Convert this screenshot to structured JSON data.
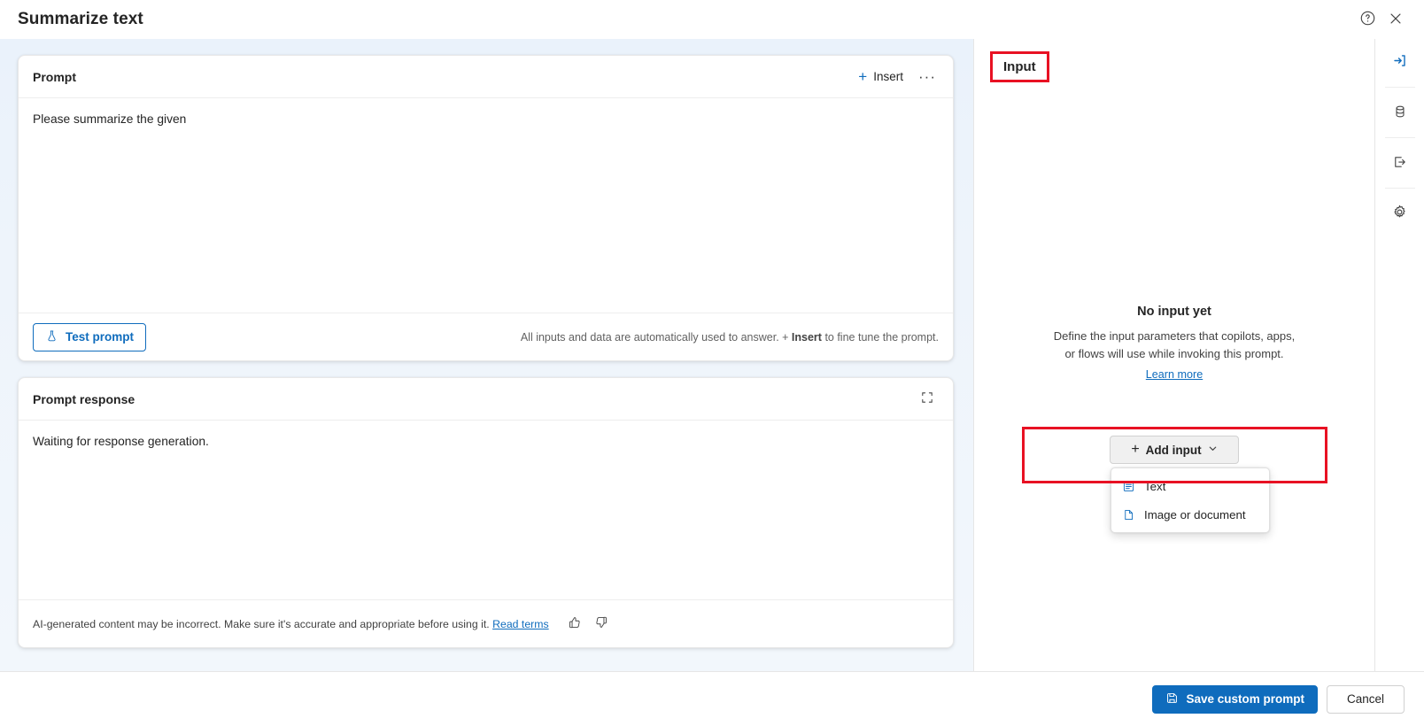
{
  "window": {
    "title": "Summarize text",
    "help_icon": "help-circle-icon",
    "close_icon": "close-icon"
  },
  "colors": {
    "accent": "#0f6cbd",
    "highlight_box": "#e81123",
    "left_pane_bg": "#eaf2fb"
  },
  "prompt_card": {
    "title": "Prompt",
    "insert_label": "Insert",
    "more_label": "···",
    "text": "Please summarize the given",
    "test_button": "Test prompt",
    "hint_prefix": "All inputs and data are automatically used to answer. + ",
    "hint_bold": "Insert",
    "hint_suffix": " to fine tune the prompt."
  },
  "response_card": {
    "title": "Prompt response",
    "expand_icon": "expand-icon",
    "text": "Waiting for response generation.",
    "disclaimer": "AI-generated content may be incorrect. Make sure it's accurate and appropriate before using it. ",
    "disclaimer_link": "Read terms",
    "thumbs_up_icon": "thumbs-up-icon",
    "thumbs_down_icon": "thumbs-down-icon"
  },
  "input_panel": {
    "heading": "Input",
    "empty_title": "No input yet",
    "empty_desc_line1": "Define the input parameters that copilots, apps,",
    "empty_desc_line2": "or flows will use while invoking this prompt.",
    "learn_more": "Learn more",
    "add_input_label": "Add input",
    "menu": [
      {
        "label": "Text",
        "icon": "text-lines-icon"
      },
      {
        "label": "Image or document",
        "icon": "document-icon"
      }
    ]
  },
  "rail": [
    {
      "name": "input",
      "icon": "arrow-into-bracket-icon",
      "active": true
    },
    {
      "name": "data",
      "icon": "database-icon",
      "active": false
    },
    {
      "name": "output",
      "icon": "arrow-out-of-bracket-icon",
      "active": false
    },
    {
      "name": "settings",
      "icon": "gear-icon",
      "active": false
    }
  ],
  "footer": {
    "save_label": "Save custom prompt",
    "save_icon": "save-disk-icon",
    "cancel_label": "Cancel"
  }
}
